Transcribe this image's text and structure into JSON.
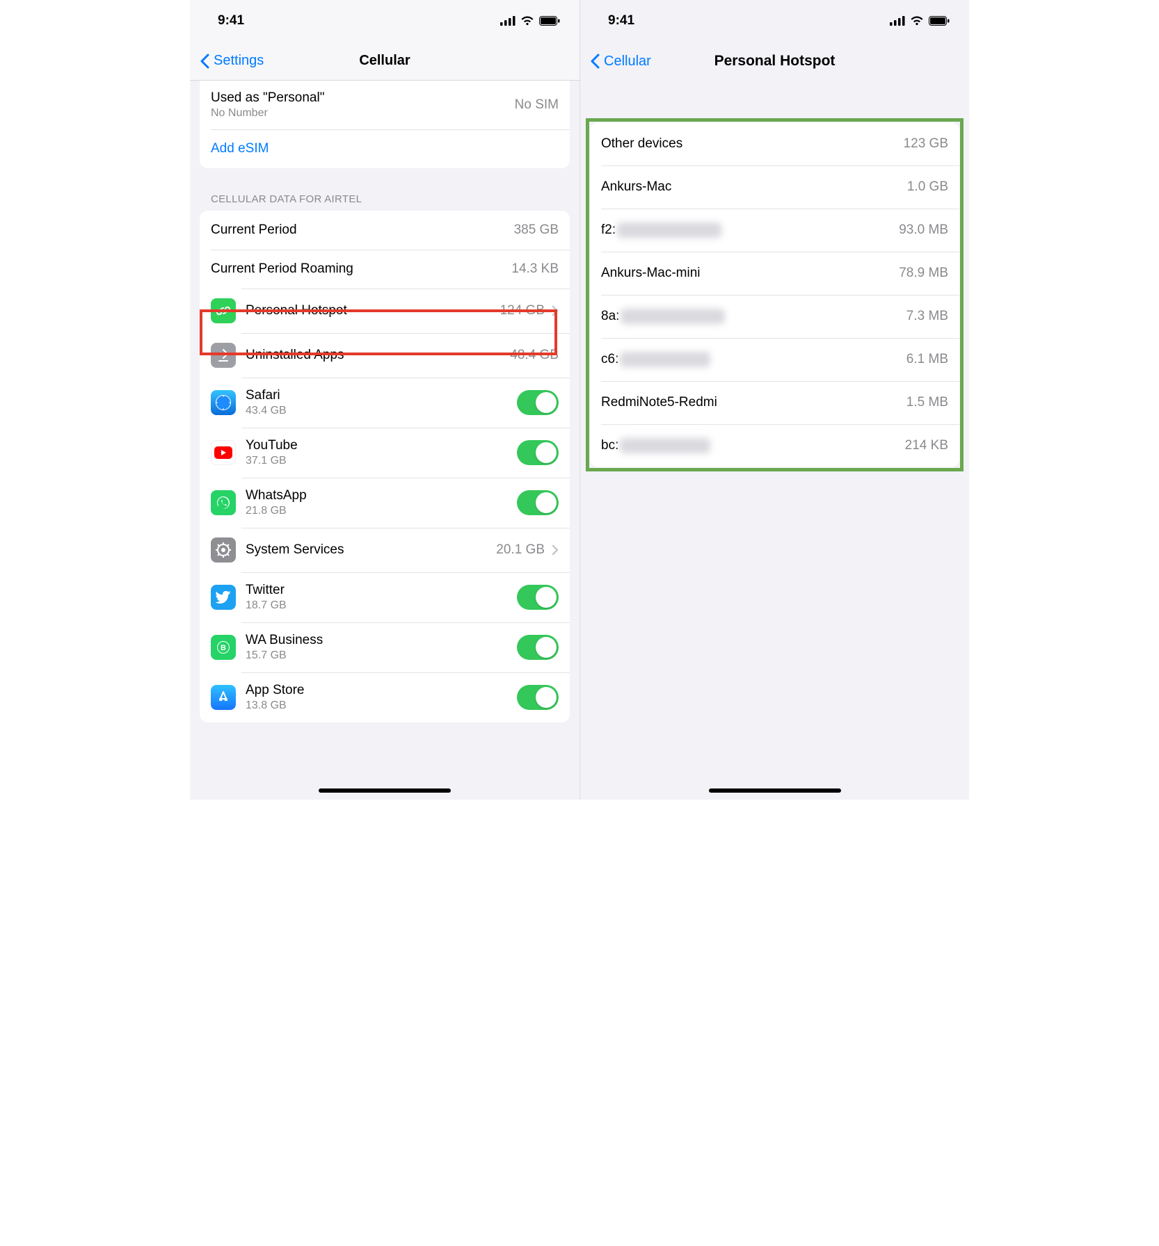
{
  "status": {
    "time": "9:41"
  },
  "left": {
    "back_label": "Settings",
    "title": "Cellular",
    "sim": {
      "used_as": "Used as \"Personal\"",
      "number": "No Number",
      "status": "No SIM",
      "add_esim": "Add eSIM"
    },
    "data_section_header": "CELLULAR DATA FOR AIRTEL",
    "current_period": {
      "label": "Current Period",
      "value": "385 GB"
    },
    "current_period_roaming": {
      "label": "Current Period Roaming",
      "value": "14.3 KB"
    },
    "personal_hotspot": {
      "label": "Personal Hotspot",
      "value": "124 GB"
    },
    "uninstalled_apps": {
      "label": "Uninstalled Apps",
      "value": "48.4 GB"
    },
    "apps": [
      {
        "name": "Safari",
        "usage": "43.4 GB"
      },
      {
        "name": "YouTube",
        "usage": "37.1 GB"
      },
      {
        "name": "WhatsApp",
        "usage": "21.8 GB"
      },
      {
        "name": "System Services",
        "usage": "20.1 GB"
      },
      {
        "name": "Twitter",
        "usage": "18.7 GB"
      },
      {
        "name": "WA Business",
        "usage": "15.7 GB"
      },
      {
        "name": "App Store",
        "usage": "13.8 GB"
      }
    ]
  },
  "right": {
    "back_label": "Cellular",
    "title": "Personal Hotspot",
    "devices": [
      {
        "name": "Other devices",
        "usage": "123 GB",
        "blurred": false
      },
      {
        "name": "Ankurs-Mac",
        "usage": "1.0 GB",
        "blurred": false
      },
      {
        "name": "f2:",
        "usage": "93.0 MB",
        "blurred": true
      },
      {
        "name": "Ankurs-Mac-mini",
        "usage": "78.9 MB",
        "blurred": false
      },
      {
        "name": "8a:",
        "usage": "7.3 MB",
        "blurred": true
      },
      {
        "name": "c6:",
        "usage": "6.1 MB",
        "blurred": true
      },
      {
        "name": "RedmiNote5-Redmi",
        "usage": "1.5 MB",
        "blurred": false
      },
      {
        "name": "bc:",
        "usage": "214 KB",
        "blurred": true
      }
    ]
  }
}
